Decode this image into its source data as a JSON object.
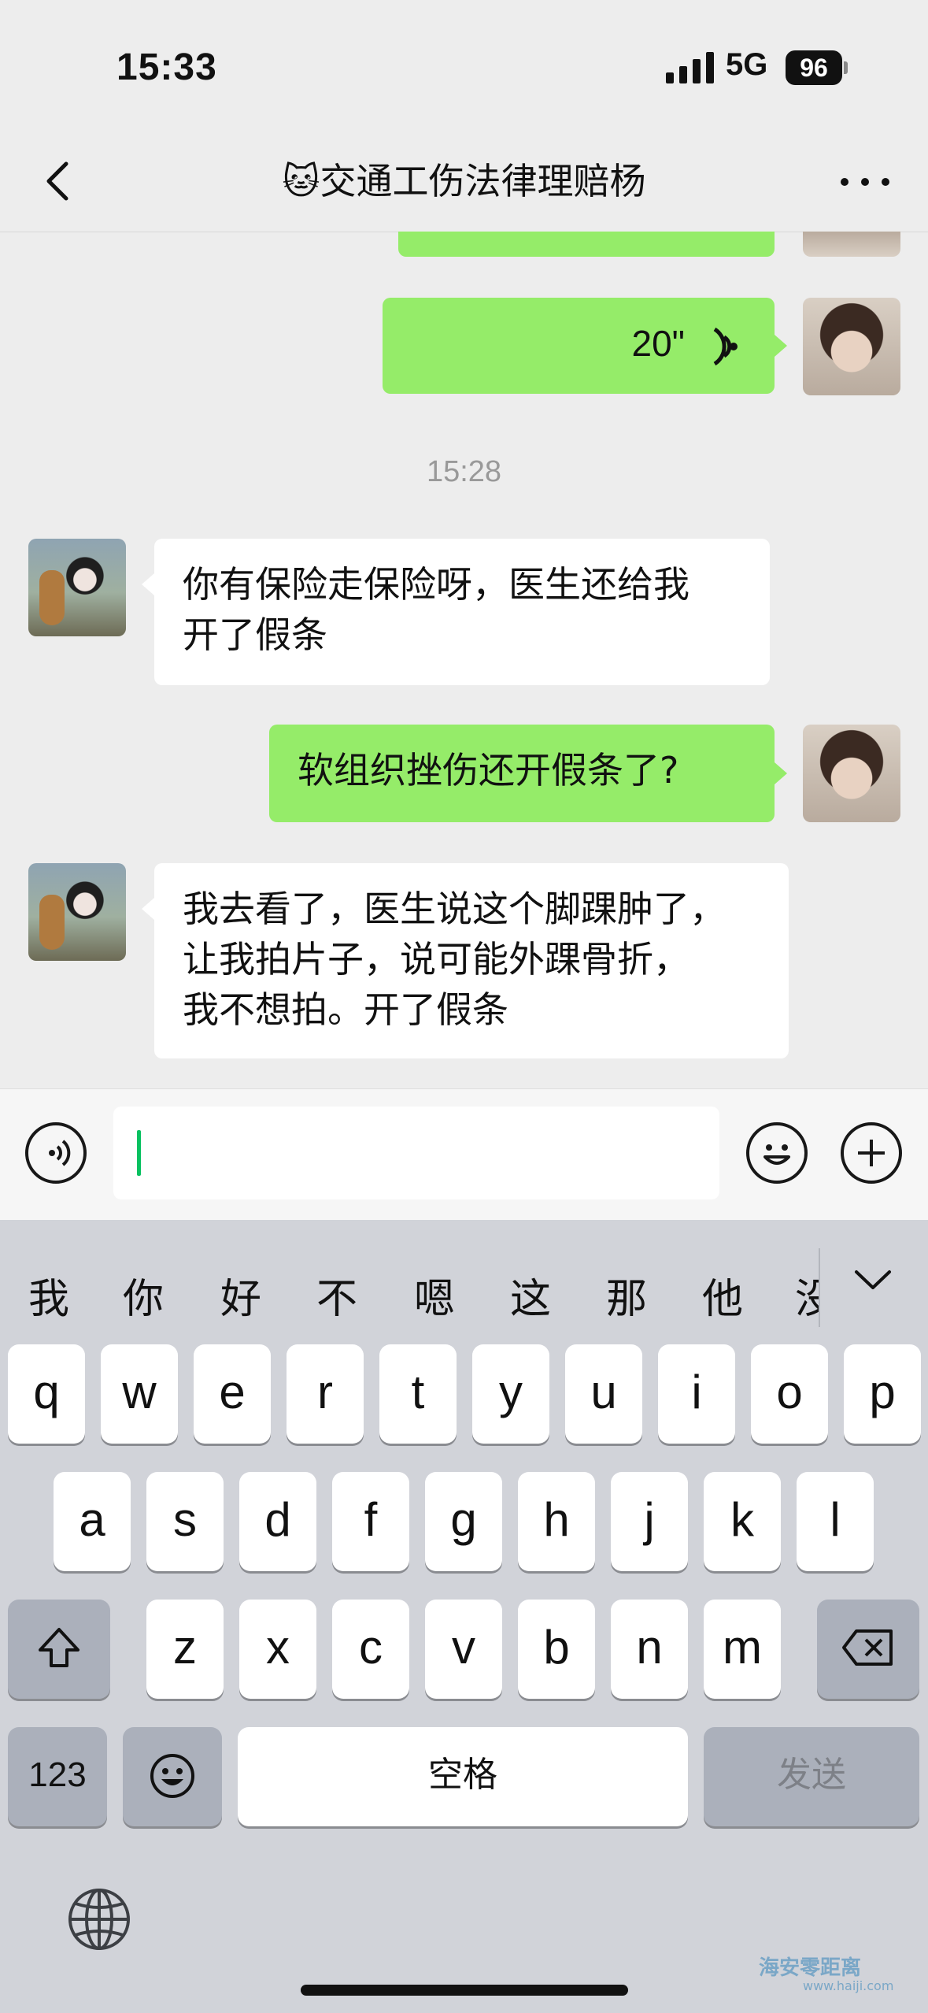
{
  "status_bar": {
    "time": "15:33",
    "network": "5G",
    "battery": "96"
  },
  "nav": {
    "title": "🐱交通工伤法律理赔杨",
    "back_icon": "chevron-left-icon",
    "more_icon": "more-horizontal-icon"
  },
  "messages": [
    {
      "sender": "me",
      "type": "voice",
      "duration": "20\""
    },
    {
      "type": "timestamp",
      "text": "15:28"
    },
    {
      "sender": "other",
      "type": "text",
      "line1": "你有保险走保险呀，医生还给我",
      "line2": "开了假条"
    },
    {
      "sender": "me",
      "type": "text",
      "text": "软组织挫伤还开假条了?"
    },
    {
      "sender": "other",
      "type": "text",
      "line1": "我去看了，医生说这个脚踝肿了，",
      "line2": "让我拍片子，说可能外踝骨折，",
      "line3": "我不想拍。开了假条"
    }
  ],
  "input_bar": {
    "value": "",
    "voice_icon": "voice-input-icon",
    "emoji_icon": "emoji-icon",
    "plus_icon": "plus-icon"
  },
  "keyboard": {
    "candidates": [
      "我",
      "你",
      "好",
      "不",
      "嗯",
      "这",
      "那",
      "他",
      "没"
    ],
    "row1": [
      "q",
      "w",
      "e",
      "r",
      "t",
      "y",
      "u",
      "i",
      "o",
      "p"
    ],
    "row2": [
      "a",
      "s",
      "d",
      "f",
      "g",
      "h",
      "j",
      "k",
      "l"
    ],
    "row3": [
      "z",
      "x",
      "c",
      "v",
      "b",
      "n",
      "m"
    ],
    "numbers_label": "123",
    "space_label": "空格",
    "send_label": "发送"
  },
  "watermark": {
    "text": "海安零距离",
    "url": "www.haiji.com"
  }
}
